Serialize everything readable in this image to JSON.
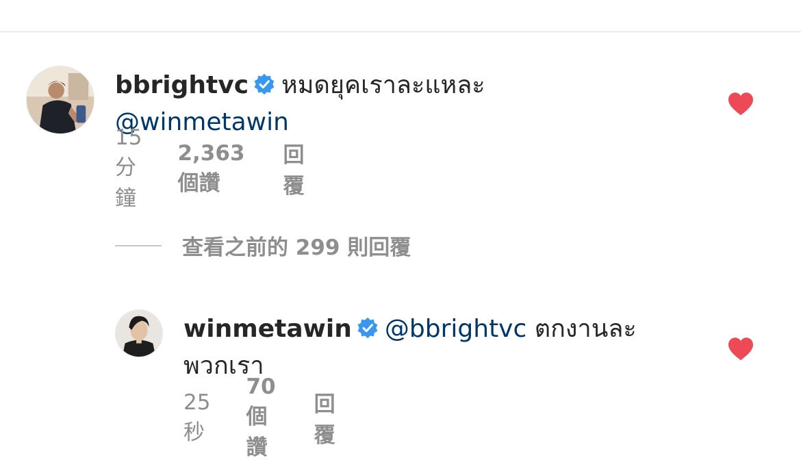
{
  "comment": {
    "username": "bbrightvc",
    "text": "หมดยุคเราละแหละ",
    "mention": "@winmetawin",
    "time": "15 分鐘",
    "likes": "2,363 個讚",
    "reply_label": "回覆",
    "liked": true
  },
  "view_replies": {
    "label": "查看之前的 299 則回覆"
  },
  "reply": {
    "username": "winmetawin",
    "mention": "@bbrightvc",
    "text_line1": "ตกงานละ",
    "text_line2": "พวกเรา",
    "time": "25 秒",
    "likes": "70 個讚",
    "reply_label": "回覆",
    "liked": true
  },
  "colors": {
    "heart": "#ed4956",
    "verified": "#3897f0",
    "mention": "#00376b",
    "meta": "#8e8e8e"
  },
  "icons": {
    "heart": "heart-icon",
    "verified": "verified-badge-icon"
  }
}
